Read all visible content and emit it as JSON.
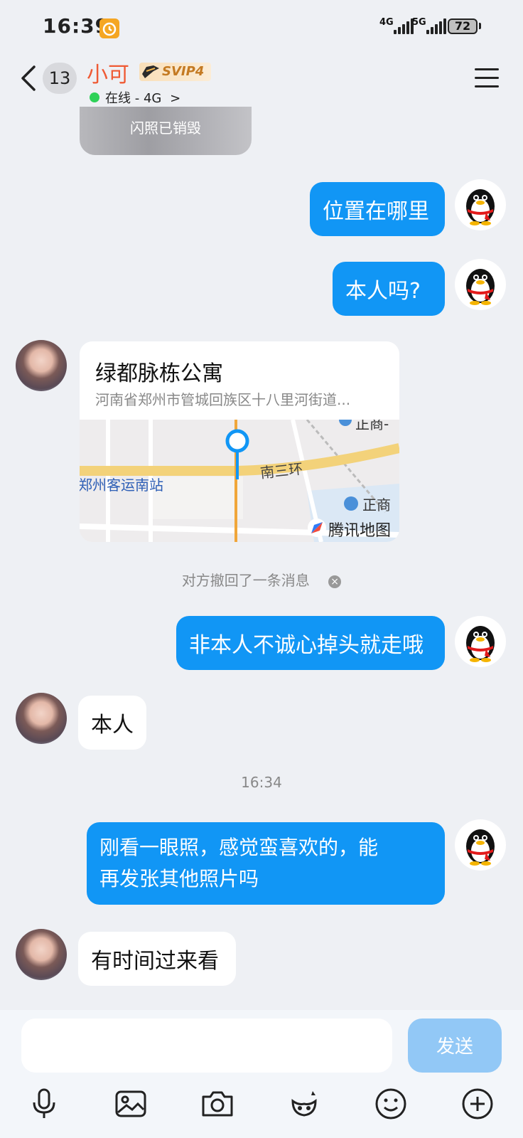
{
  "status_bar": {
    "time": "16:39",
    "net1": "4G",
    "net2": "5G",
    "battery": "72"
  },
  "header": {
    "unread_count": "13",
    "contact_name": "小可",
    "vip_label": "SVIP4",
    "online_status": "在线 - 4G",
    "online_chevron": ">"
  },
  "messages": {
    "flash_photo": "闪照已销毁",
    "m1": "位置在哪里",
    "m2": "本人吗?",
    "location": {
      "name": "绿都脉栋公寓",
      "address": "河南省郑州市管城回族区十八里河街道...",
      "map_road": "南三环",
      "map_station": "郑州客运南站",
      "map_poi1": "正商",
      "map_poi_top": "正商-",
      "map_brand": "腾讯地图"
    },
    "recalled": "对方撤回了一条消息",
    "m3": "非本人不诚心掉头就走哦",
    "m4": "本人",
    "time": "16:34",
    "m5_line1": "刚看一眼照，感觉蛮喜欢的，能",
    "m5_line2": "再发张其他照片吗",
    "m6": "有时间过来看"
  },
  "input": {
    "value": "",
    "send_label": "发送"
  },
  "toolbar": {
    "icons": [
      "microphone-icon",
      "image-icon",
      "camera-icon",
      "hongbao-icon",
      "emoji-icon",
      "plus-icon"
    ]
  },
  "colors": {
    "accent": "#1196f5",
    "name": "#ef5a34",
    "online": "#2ed158"
  }
}
